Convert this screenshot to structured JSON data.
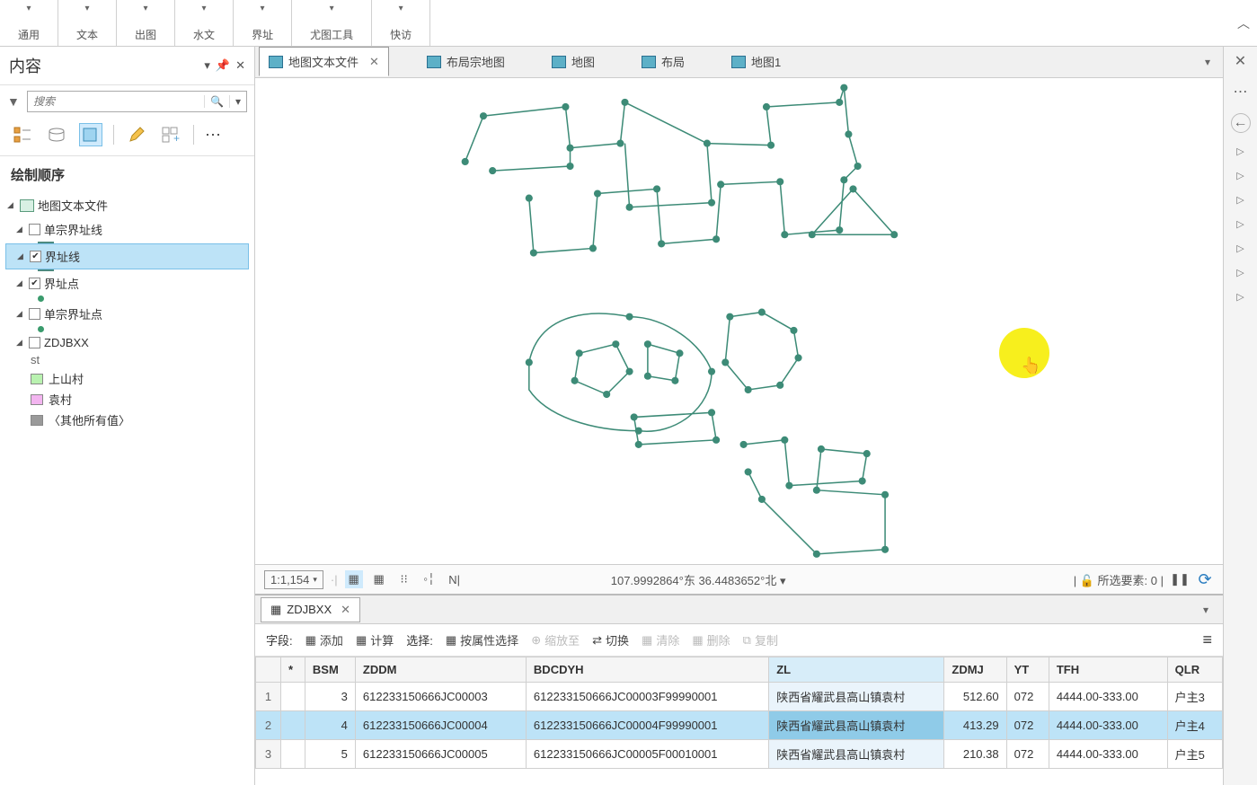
{
  "ribbon": {
    "groups": [
      "通用",
      "文本",
      "出图",
      "水文",
      "界址",
      "尤图工具",
      "快访"
    ]
  },
  "contents_panel": {
    "title": "内容",
    "search_placeholder": "搜索",
    "section": "绘制顺序",
    "map_name": "地图文本文件",
    "layers": [
      {
        "name": "单宗界址线",
        "checked": false,
        "type": "line"
      },
      {
        "name": "界址线",
        "checked": true,
        "type": "line",
        "selected": true
      },
      {
        "name": "界址点",
        "checked": true,
        "type": "point"
      },
      {
        "name": "单宗界址点",
        "checked": false,
        "type": "point"
      },
      {
        "name": "ZDJBXX",
        "checked": false,
        "type": "poly",
        "sub_label": "st",
        "classes": [
          {
            "label": "上山村",
            "color": "#b9f2b0"
          },
          {
            "label": "袁村",
            "color": "#f3b5f0"
          },
          {
            "label": "〈其他所有值〉",
            "color": "#9a9a9a"
          }
        ]
      }
    ]
  },
  "tabs": [
    {
      "label": "地图文本文件",
      "active": true,
      "closable": true
    },
    {
      "label": "布局宗地图"
    },
    {
      "label": "地图"
    },
    {
      "label": "布局"
    },
    {
      "label": "地图1"
    }
  ],
  "statusbar": {
    "scale": "1:1,154",
    "coords": "107.9992864°东 36.4483652°北",
    "selected_label": "所选要素:",
    "selected_count": "0"
  },
  "attr_table": {
    "name": "ZDJBXX",
    "fields_label": "字段:",
    "add": "添加",
    "calc": "计算",
    "select_label": "选择:",
    "sel_by_attr": "按属性选择",
    "zoom_to": "缩放至",
    "switch": "切换",
    "clear": "清除",
    "delete": "删除",
    "copy": "复制",
    "columns": [
      " *",
      "BSM",
      "ZDDM",
      "BDCDYH",
      "ZL",
      "ZDMJ",
      "YT",
      "TFH",
      "QLR"
    ],
    "rows": [
      {
        "n": "1",
        "bsm": "3",
        "zddm": "612233150666JC00003",
        "bdcdyh": "612233150666JC00003F99990001",
        "zl": "陕西省耀武县高山镇袁村",
        "zdmj": "512.60",
        "yt": "072",
        "tfh": "4444.00-333.00",
        "qlr": "户主3"
      },
      {
        "n": "2",
        "bsm": "4",
        "zddm": "612233150666JC00004",
        "bdcdyh": "612233150666JC00004F99990001",
        "zl": "陕西省耀武县高山镇袁村",
        "zdmj": "413.29",
        "yt": "072",
        "tfh": "4444.00-333.00",
        "qlr": "户主4",
        "selected": true
      },
      {
        "n": "3",
        "bsm": "5",
        "zddm": "612233150666JC00005",
        "bdcdyh": "612233150666JC00005F00010001",
        "zl": "陕西省耀武县高山镇袁村",
        "zdmj": "210.38",
        "yt": "072",
        "tfh": "4444.00-333.00",
        "qlr": "户主5"
      }
    ]
  }
}
